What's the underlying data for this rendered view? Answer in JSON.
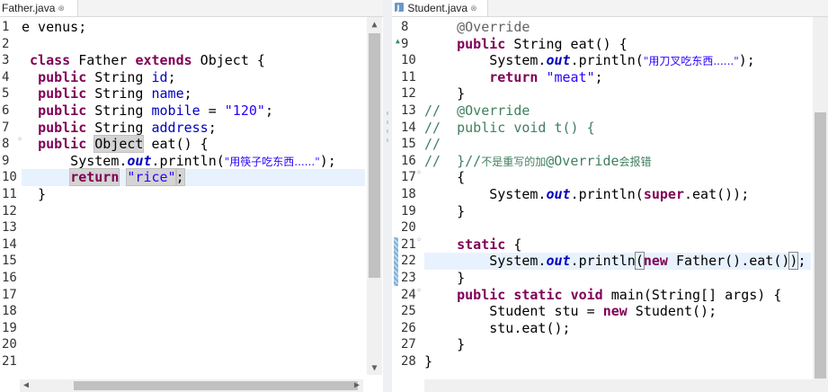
{
  "left": {
    "tab_label": "Father.java",
    "close_glyph": "⊗",
    "lines": [
      {
        "n": "1",
        "t": [
          {
            "c": "e venus;"
          }
        ]
      },
      {
        "n": "2",
        "t": []
      },
      {
        "n": "3",
        "t": [
          {
            "c": " "
          },
          {
            "c": "class",
            "k": "kw"
          },
          {
            "c": " Father "
          },
          {
            "c": "extends",
            "k": "kw"
          },
          {
            "c": " Object {"
          }
        ]
      },
      {
        "n": "4",
        "t": [
          {
            "c": "  "
          },
          {
            "c": "public",
            "k": "kw"
          },
          {
            "c": " String "
          },
          {
            "c": "id",
            "k": "fld"
          },
          {
            "c": ";"
          }
        ]
      },
      {
        "n": "5",
        "t": [
          {
            "c": "  "
          },
          {
            "c": "public",
            "k": "kw"
          },
          {
            "c": " String "
          },
          {
            "c": "name",
            "k": "fld"
          },
          {
            "c": ";"
          }
        ]
      },
      {
        "n": "6",
        "t": [
          {
            "c": "  "
          },
          {
            "c": "public",
            "k": "kw"
          },
          {
            "c": " String "
          },
          {
            "c": "mobile",
            "k": "fld"
          },
          {
            "c": " = "
          },
          {
            "c": "\"120\"",
            "k": "str"
          },
          {
            "c": ";"
          }
        ]
      },
      {
        "n": "7",
        "t": [
          {
            "c": "  "
          },
          {
            "c": "public",
            "k": "kw"
          },
          {
            "c": " String "
          },
          {
            "c": "address",
            "k": "fld"
          },
          {
            "c": ";"
          }
        ]
      },
      {
        "n": "8◦",
        "t": [
          {
            "c": "  "
          },
          {
            "c": "public",
            "k": "kw"
          },
          {
            "c": " "
          },
          {
            "c": "Object",
            "k": "occ"
          },
          {
            "c": " eat() {"
          }
        ]
      },
      {
        "n": "9",
        "t": [
          {
            "c": "      System."
          },
          {
            "c": "out",
            "k": "static-fld"
          },
          {
            "c": ".println("
          },
          {
            "c": "\"用筷子吃东西......\"",
            "k": "str cn"
          },
          {
            "c": ");"
          }
        ]
      },
      {
        "n": "10",
        "t": [
          {
            "c": "      "
          },
          {
            "c": "return",
            "k": "kw occ"
          },
          {
            "c": " "
          },
          {
            "c": "\"rice\"",
            "k": "str occ"
          },
          {
            "c": ";",
            "k": "occ"
          }
        ]
      },
      {
        "n": "11",
        "t": [
          {
            "c": "  }"
          }
        ]
      },
      {
        "n": "12",
        "t": []
      },
      {
        "n": "13",
        "t": []
      },
      {
        "n": "14",
        "t": []
      },
      {
        "n": "15",
        "t": []
      },
      {
        "n": "16",
        "t": []
      },
      {
        "n": "17",
        "t": []
      },
      {
        "n": "18",
        "t": []
      },
      {
        "n": "19",
        "t": []
      },
      {
        "n": "20",
        "t": []
      },
      {
        "n": "21",
        "t": []
      }
    ],
    "current_line": 10
  },
  "right": {
    "tab_label": "Student.java",
    "close_glyph": "⊗",
    "lines": [
      {
        "n": "8",
        "t": [
          {
            "c": "    "
          },
          {
            "c": "@Override",
            "k": "ann"
          }
        ]
      },
      {
        "n": "9",
        "t": [
          {
            "c": "    "
          },
          {
            "c": "public",
            "k": "kw"
          },
          {
            "c": " String eat() {"
          }
        ]
      },
      {
        "n": "10",
        "t": [
          {
            "c": "        System."
          },
          {
            "c": "out",
            "k": "static-fld"
          },
          {
            "c": ".println("
          },
          {
            "c": "\"用刀叉吃东西......\"",
            "k": "str cn"
          },
          {
            "c": ");"
          }
        ]
      },
      {
        "n": "11",
        "t": [
          {
            "c": "        "
          },
          {
            "c": "return",
            "k": "kw"
          },
          {
            "c": " "
          },
          {
            "c": "\"meat\"",
            "k": "str"
          },
          {
            "c": ";"
          }
        ]
      },
      {
        "n": "12",
        "t": [
          {
            "c": "    }"
          }
        ]
      },
      {
        "n": "13",
        "t": [
          {
            "c": "//  ",
            "k": "cmt"
          },
          {
            "c": "@Override",
            "k": "cmt"
          }
        ]
      },
      {
        "n": "14",
        "t": [
          {
            "c": "//  public void t() {",
            "k": "cmt"
          }
        ]
      },
      {
        "n": "15",
        "t": [
          {
            "c": "//",
            "k": "cmt"
          }
        ]
      },
      {
        "n": "16",
        "t": [
          {
            "c": "//  }//",
            "k": "cmt"
          },
          {
            "c": "不是重写的加",
            "k": "cmt cn"
          },
          {
            "c": "@Override",
            "k": "cmt"
          },
          {
            "c": "会报错",
            "k": "cmt cn"
          }
        ]
      },
      {
        "n": "17◦",
        "t": [
          {
            "c": "    {"
          }
        ]
      },
      {
        "n": "18",
        "t": [
          {
            "c": "        System."
          },
          {
            "c": "out",
            "k": "static-fld"
          },
          {
            "c": ".println("
          },
          {
            "c": "super",
            "k": "kw"
          },
          {
            "c": ".eat());"
          }
        ]
      },
      {
        "n": "19",
        "t": [
          {
            "c": "    }"
          }
        ]
      },
      {
        "n": "20",
        "t": []
      },
      {
        "n": "21◦",
        "t": [
          {
            "c": "    "
          },
          {
            "c": "static",
            "k": "kw"
          },
          {
            "c": " {"
          }
        ]
      },
      {
        "n": "22",
        "t": [
          {
            "c": "        System."
          },
          {
            "c": "out",
            "k": "static-fld"
          },
          {
            "c": ".println"
          },
          {
            "c": "(",
            "k": "bracket"
          },
          {
            "c": "new",
            "k": "kw"
          },
          {
            "c": " Father().eat()"
          },
          {
            "c": ")",
            "k": "bracket"
          },
          {
            "c": ";"
          }
        ]
      },
      {
        "n": "23",
        "t": [
          {
            "c": "    }"
          }
        ]
      },
      {
        "n": "24◦",
        "t": [
          {
            "c": "    "
          },
          {
            "c": "public",
            "k": "kw"
          },
          {
            "c": " "
          },
          {
            "c": "static",
            "k": "kw"
          },
          {
            "c": " "
          },
          {
            "c": "void",
            "k": "kw"
          },
          {
            "c": " main(String[] args) {"
          }
        ]
      },
      {
        "n": "25",
        "t": [
          {
            "c": "        Student "
          },
          {
            "c": "stu",
            "k": "plain"
          },
          {
            "c": " = "
          },
          {
            "c": "new",
            "k": "kw"
          },
          {
            "c": " Student();"
          }
        ]
      },
      {
        "n": "26",
        "t": [
          {
            "c": "        stu.eat();"
          }
        ]
      },
      {
        "n": "27",
        "t": [
          {
            "c": "    }"
          }
        ]
      },
      {
        "n": "28",
        "t": [
          {
            "c": "}"
          }
        ]
      }
    ],
    "current_line": 22
  },
  "icons": {
    "java_file": "java-file-icon",
    "close": "close-icon",
    "override_marker": "override-triangle-icon"
  },
  "colors": {
    "keyword": "#7f0055",
    "string": "#2a00ff",
    "field": "#0000c0",
    "comment": "#3f7f5f",
    "annotation": "#646464",
    "current_line": "#e8f2fe"
  }
}
